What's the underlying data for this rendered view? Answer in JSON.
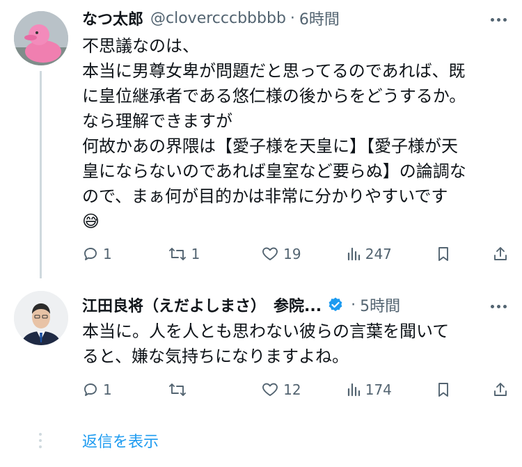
{
  "tweet1": {
    "name": "なつ太郎",
    "handle": "@clovercccc bbbbb",
    "handle_text": "@clovercccbbbbb",
    "separator": "·",
    "time": "6時間",
    "lines": [
      "不思議なのは、",
      "本当に男尊女卑が問題だと思ってるのであれば、既",
      "に皇位継承者である悠仁様の後からをどうするか。",
      "なら理解できますが",
      "何故かあの界隈は【愛子様を天皇に】【愛子様が天",
      "皇にならないのであれば皇室など要らぬ】の論調な",
      "ので、まぁ何が目的かは非常に分かりやすいです"
    ],
    "emoji": "😅",
    "reply_count": "1",
    "retweet_count": "1",
    "like_count": "19",
    "view_count": "247"
  },
  "tweet2": {
    "name": "江田良将（えだよしまさ）　参院...",
    "separator": "·",
    "time": "5時間",
    "lines": [
      "本当に。人を人とも思わない彼らの言葉を聞いて",
      "ると、嫌な気持ちになりますよね。"
    ],
    "reply_count": "1",
    "like_count": "12",
    "view_count": "174"
  },
  "show_replies_label": "返信を表示",
  "colors": {
    "text": "#0f1419",
    "muted": "#536471",
    "link": "#1d9bf0",
    "line": "#cfd9de"
  },
  "icons": [
    "reply-icon",
    "retweet-icon",
    "like-icon",
    "views-icon",
    "bookmark-icon",
    "share-icon",
    "verified-badge-icon",
    "more-icon"
  ]
}
